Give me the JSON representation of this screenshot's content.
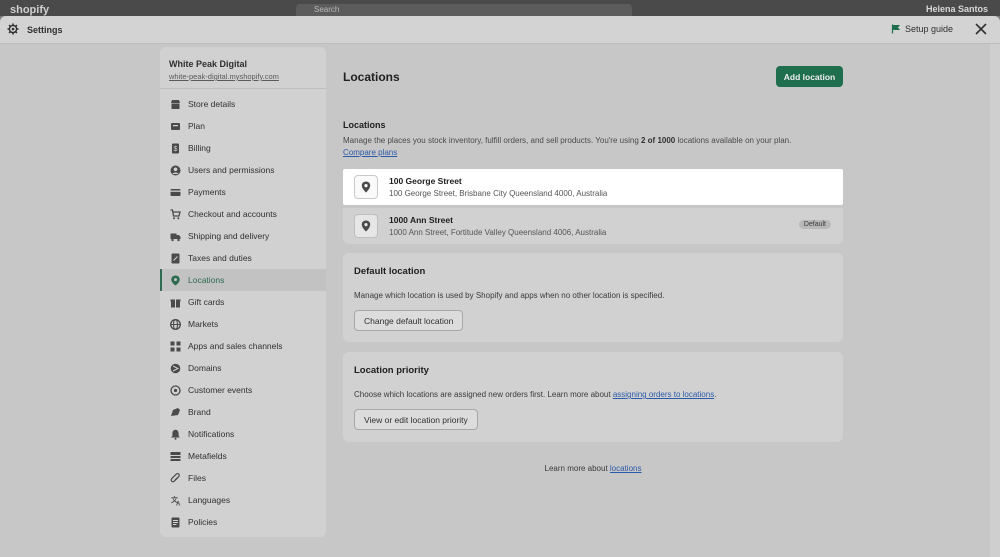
{
  "background": {
    "logo_text": "shopify",
    "search_placeholder": "Search",
    "user_name": "Helena Santos"
  },
  "header": {
    "title": "Settings",
    "setup_guide": "Setup guide",
    "gear_icon": "gear-icon",
    "close_icon": "close-icon"
  },
  "store": {
    "name": "White Peak Digital",
    "url": "white-peak-digital.myshopify.com"
  },
  "sidebar": {
    "items": [
      {
        "label": "Store details",
        "icon": "store-icon"
      },
      {
        "label": "Plan",
        "icon": "plan-icon"
      },
      {
        "label": "Billing",
        "icon": "billing-icon"
      },
      {
        "label": "Users and permissions",
        "icon": "user-icon"
      },
      {
        "label": "Payments",
        "icon": "payments-icon"
      },
      {
        "label": "Checkout and accounts",
        "icon": "cart-icon"
      },
      {
        "label": "Shipping and delivery",
        "icon": "truck-icon"
      },
      {
        "label": "Taxes and duties",
        "icon": "tax-icon"
      },
      {
        "label": "Locations",
        "icon": "location-pin-icon",
        "active": true
      },
      {
        "label": "Gift cards",
        "icon": "gift-icon"
      },
      {
        "label": "Markets",
        "icon": "globe-icon"
      },
      {
        "label": "Apps and sales channels",
        "icon": "apps-icon"
      },
      {
        "label": "Domains",
        "icon": "domain-icon"
      },
      {
        "label": "Customer events",
        "icon": "events-icon"
      },
      {
        "label": "Brand",
        "icon": "brand-icon"
      },
      {
        "label": "Notifications",
        "icon": "bell-icon"
      },
      {
        "label": "Metafields",
        "icon": "metafields-icon"
      },
      {
        "label": "Files",
        "icon": "paperclip-icon"
      },
      {
        "label": "Languages",
        "icon": "language-icon"
      },
      {
        "label": "Policies",
        "icon": "policy-icon"
      }
    ]
  },
  "main": {
    "title": "Locations",
    "add_button": "Add location",
    "section_heading": "Locations",
    "desc_part1": "Manage the places you stock inventory, fulfill orders, and sell products. You're using ",
    "desc_bold": "2 of 1000",
    "desc_part2": " locations available on your plan. ",
    "compare_link": "Compare plans",
    "locations": [
      {
        "name": "100 George Street",
        "address": "100 George Street, Brisbane City Queensland 4000, Australia"
      },
      {
        "name": "1000 Ann Street",
        "address": "1000 Ann Street, Fortitude Valley Queensland 4006, Australia",
        "badge": "Default"
      }
    ],
    "default_card": {
      "title": "Default location",
      "text": "Manage which location is used by Shopify and apps when no other location is specified.",
      "button": "Change default location"
    },
    "priority_card": {
      "title": "Location priority",
      "text_before": "Choose which locations are assigned new orders first. Learn more about ",
      "link": "assigning orders to locations",
      "text_after": ".",
      "button": "View or edit location priority"
    },
    "footer": {
      "text": "Learn more about ",
      "link": "locations"
    }
  }
}
